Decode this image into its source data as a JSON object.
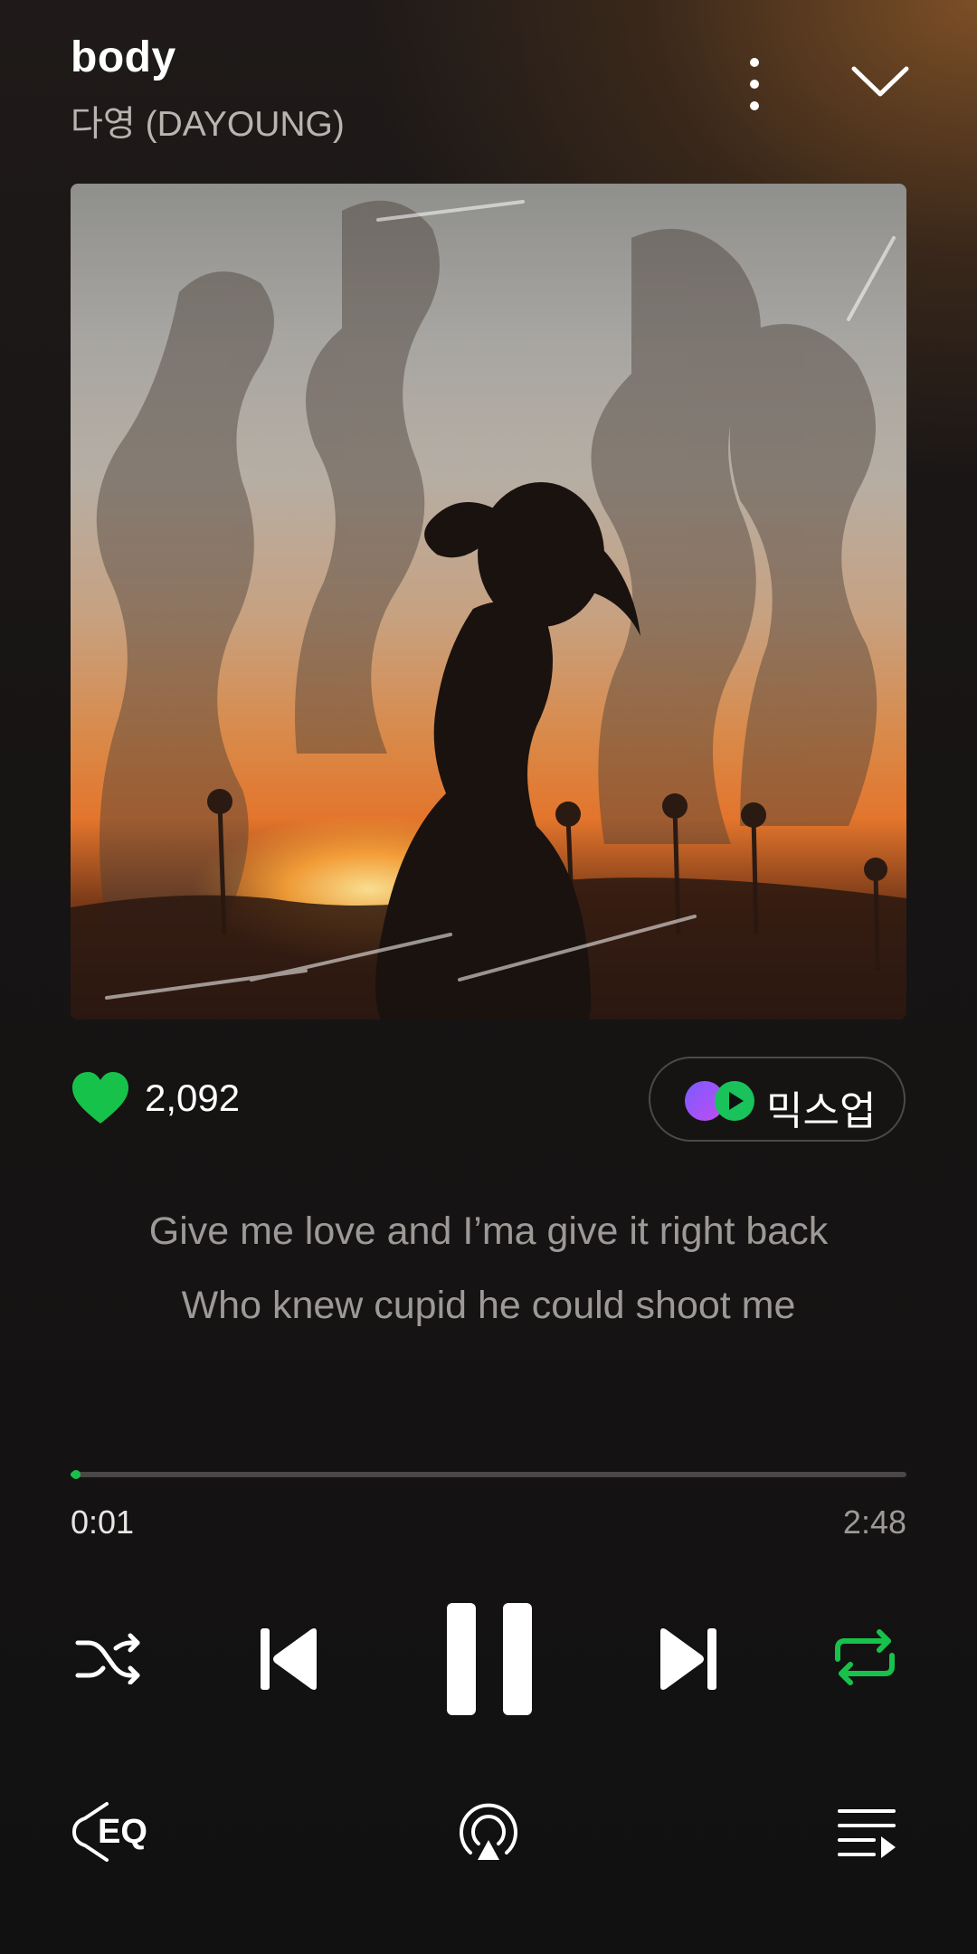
{
  "header": {
    "title": "body",
    "artist": "다영 (DAYOUNG)",
    "more_icon": "more-vertical-icon",
    "collapse_icon": "chevron-down-icon"
  },
  "album_art": {
    "description_icon": "album-cover-image"
  },
  "likes": {
    "count": "2,092",
    "icon": "heart-icon",
    "color": "#17c24a"
  },
  "mixup": {
    "label": "믹스업",
    "icon": "mixup-icon"
  },
  "lyrics": {
    "lines": [
      "Give me love and I’ma give it right back",
      "Who knew cupid he could shoot me"
    ]
  },
  "playback": {
    "current_time": "0:01",
    "total_time": "2:48",
    "progress_fraction": 0.006,
    "accent_color": "#17c24a"
  },
  "controls": {
    "shuffle_icon": "shuffle-icon",
    "previous_icon": "skip-previous-icon",
    "pause_icon": "pause-icon",
    "next_icon": "skip-next-icon",
    "repeat_icon": "repeat-icon",
    "repeat_active": true
  },
  "bottom_bar": {
    "eq_label": "EQ",
    "eq_icon": "equalizer-icon",
    "cast_icon": "airplay-icon",
    "queue_icon": "playlist-icon"
  }
}
